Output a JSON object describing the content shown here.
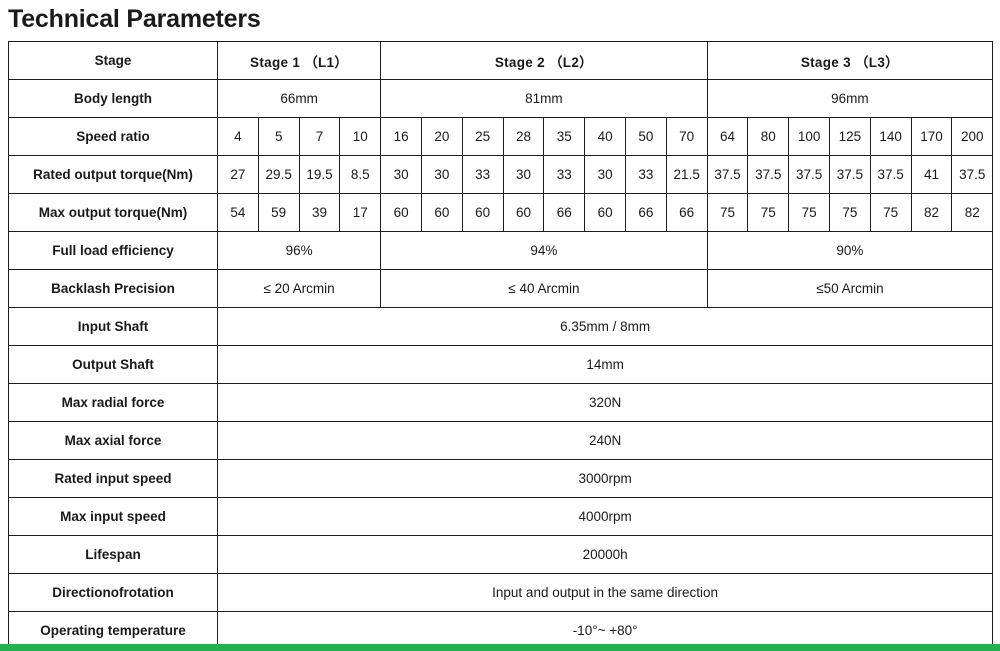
{
  "title": "Technical Parameters",
  "colors": {
    "header_green": "#6b9d8a",
    "bottom_bar_green": "#22b14c",
    "border": "#1e1e1e",
    "label_text": "#ffffff",
    "value_text": "#1a1a1a"
  },
  "table": {
    "row_labels": {
      "stage": "Stage",
      "body_length": "Body length",
      "speed_ratio": "Speed ratio",
      "rated_output_torque": "Rated output torque(Nm)",
      "max_output_torque": "Max output torque(Nm)",
      "full_load_efficiency": "Full load efficiency",
      "backlash_precision": "Backlash Precision",
      "input_shaft": "Input Shaft",
      "output_shaft": "Output Shaft",
      "max_radial_force": "Max radial force",
      "max_axial_force": "Max axial force",
      "rated_input_speed": "Rated input speed",
      "max_input_speed": "Max input speed",
      "lifespan": "Lifespan",
      "direction_of_rotation": "Directionofrotation",
      "operating_temperature": "Operating temperature"
    },
    "stages": [
      {
        "name": "Stage 1 （L1）",
        "body_length": "66mm",
        "efficiency": "96%",
        "backlash": "≤ 20 Arcmin"
      },
      {
        "name": "Stage 2 （L2）",
        "body_length": "81mm",
        "efficiency": "94%",
        "backlash": "≤ 40 Arcmin"
      },
      {
        "name": "Stage 3 （L3）",
        "body_length": "96mm",
        "efficiency": "90%",
        "backlash": "≤50 Arcmin"
      }
    ],
    "speed_ratio": {
      "stage1": [
        "4",
        "5",
        "7",
        "10"
      ],
      "stage2": [
        "16",
        "20",
        "25",
        "28",
        "35",
        "40",
        "50",
        "70"
      ],
      "stage3": [
        "64",
        "80",
        "100",
        "125",
        "140",
        "170",
        "200"
      ]
    },
    "rated_output_torque": {
      "stage1": [
        "27",
        "29.5",
        "19.5",
        "8.5"
      ],
      "stage2": [
        "30",
        "30",
        "33",
        "30",
        "33",
        "30",
        "33",
        "21.5"
      ],
      "stage3": [
        "37.5",
        "37.5",
        "37.5",
        "37.5",
        "37.5",
        "41",
        "37.5"
      ]
    },
    "max_output_torque": {
      "stage1": [
        "54",
        "59",
        "39",
        "17"
      ],
      "stage2": [
        "60",
        "60",
        "60",
        "60",
        "66",
        "60",
        "66",
        "66"
      ],
      "stage3": [
        "75",
        "75",
        "75",
        "75",
        "75",
        "82",
        "82"
      ]
    },
    "common_values": {
      "input_shaft": "6.35mm / 8mm",
      "output_shaft": "14mm",
      "max_radial_force": "320N",
      "max_axial_force": "240N",
      "rated_input_speed": "3000rpm",
      "max_input_speed": "4000rpm",
      "lifespan": "20000h",
      "direction_of_rotation": "Input and output in the same direction",
      "operating_temperature": "-10°~ +80°"
    }
  }
}
